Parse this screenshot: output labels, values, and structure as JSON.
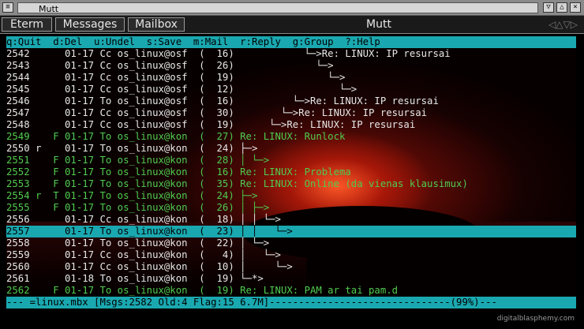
{
  "window": {
    "title": "Mutt",
    "menu_glyph": "≡",
    "buttons": [
      "▽",
      "△",
      "×"
    ]
  },
  "menubar": {
    "items": [
      "Eterm",
      "Messages",
      "Mailbox"
    ],
    "center_label": "Mutt",
    "scroll_arrows": "◁△▽▷"
  },
  "help_line": "q:Quit  d:Del  u:Undel  s:Save  m:Mail  r:Reply  g:Group  ?:Help",
  "messages": [
    {
      "line": "2542      01-17 Cc os_linux@osf  (  16)            └─>Re: LINUX: IP resursai",
      "style": "white"
    },
    {
      "line": "2543      01-17 Cc os_linux@osf  (  26)              └─>",
      "style": "white"
    },
    {
      "line": "2544      01-17 Cc os_linux@osf  (  19)                └─>",
      "style": "white"
    },
    {
      "line": "2545      01-17 Cc os_linux@osf  (  12)                  └─>",
      "style": "white"
    },
    {
      "line": "2546      01-17 To os_linux@osf  (  16)          └─>Re: LINUX: IP resursai",
      "style": "white"
    },
    {
      "line": "2547      01-17 Cc os_linux@osf  (  30)        └─>Re: LINUX: IP resursai",
      "style": "white"
    },
    {
      "line": "2548      01-17 Cc os_linux@osf  (  19)      └─>Re: LINUX: IP resursai",
      "style": "white"
    },
    {
      "line": "2549    F 01-17 To os_linux@kon  (  27) Re: LINUX: Runlock",
      "style": "green"
    },
    {
      "line": "2550 r    01-17 To os_linux@kon  (  24) ├─>",
      "style": "white"
    },
    {
      "line": "2551    F 01-17 To os_linux@kon  (  28) │ └─>",
      "style": "green"
    },
    {
      "line": "2552    F 01-17 To os_linux@kon  (  16) Re: LINUX: Problema",
      "style": "green"
    },
    {
      "line": "2553    F 01-17 To os_linux@kon  (  35) Re: LINUX: Online (da vienas klausimux)",
      "style": "green"
    },
    {
      "line": "2554 r  T 01-17 To os_linux@kon  (  24) ├─>",
      "style": "green"
    },
    {
      "line": "2555    F 01-17 To os_linux@kon  (  26) │ ├─>",
      "style": "green"
    },
    {
      "line": "2556      01-17 Cc os_linux@kon  (  18) │ │ └─>",
      "style": "white"
    },
    {
      "line": "2557      01-17 To os_linux@kon  (  23) │ │   └─>",
      "style": "sel"
    },
    {
      "line": "2558      01-17 To os_linux@kon  (  22) │ └─>",
      "style": "white"
    },
    {
      "line": "2559      01-17 Cc os_linux@kon  (   4) │   └─>",
      "style": "white"
    },
    {
      "line": "2560      01-17 Cc os_linux@kon  (  10) │     └─>",
      "style": "white"
    },
    {
      "line": "2561      01-18 To os_linux@kon  (  19) └─*>",
      "style": "white"
    },
    {
      "line": "2562    F 01-17 To os_linux@kon  (  19) Re: LINUX: PAM ar tai pam.d",
      "style": "green"
    }
  ],
  "status_line": "--- =linux.mbx [Msgs:2582 Old:4 Flag:15 6.7M]-------------------------------(99%)---",
  "watermark": "digitalblasphemy.com"
}
